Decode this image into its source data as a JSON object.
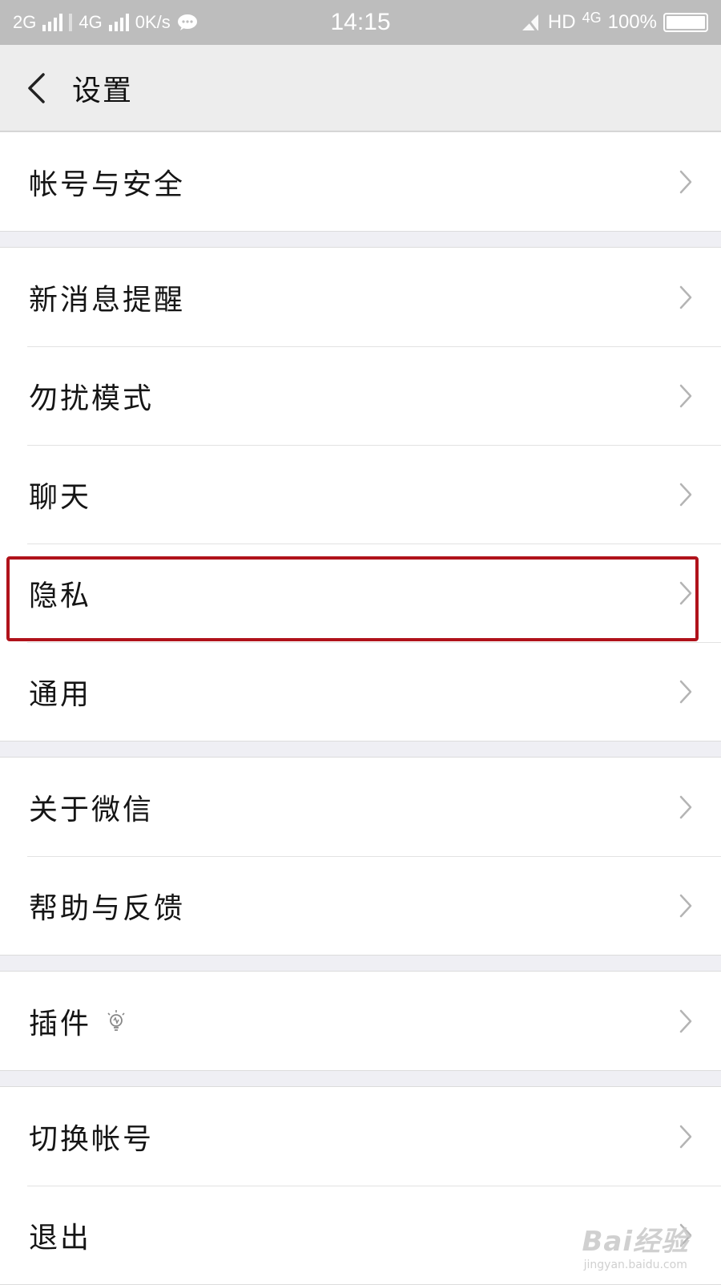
{
  "status_bar": {
    "sim1": "2G",
    "sim2": "4G",
    "speed": "0K/s",
    "time": "14:15",
    "hd": "HD",
    "net": "4G",
    "battery": "100%"
  },
  "header": {
    "title": "设置",
    "back_icon": "chevron-left-icon"
  },
  "groups": [
    {
      "items": [
        {
          "label": "帐号与安全"
        }
      ]
    },
    {
      "items": [
        {
          "label": "新消息提醒"
        },
        {
          "label": "勿扰模式"
        },
        {
          "label": "聊天"
        },
        {
          "label": "隐私",
          "highlighted": true
        },
        {
          "label": "通用"
        }
      ]
    },
    {
      "items": [
        {
          "label": "关于微信"
        },
        {
          "label": "帮助与反馈"
        }
      ]
    },
    {
      "items": [
        {
          "label": "插件",
          "icon": "lightbulb-icon"
        }
      ]
    },
    {
      "items": [
        {
          "label": "切换帐号"
        },
        {
          "label": "退出"
        }
      ]
    }
  ],
  "watermark": {
    "main": "Bai经验",
    "sub": "jingyan.baidu.com"
  },
  "colors": {
    "status_bar": "#bdbdbd",
    "header_bg": "#ededed",
    "page_bg": "#efeff4",
    "highlight_border": "#b0121b"
  }
}
